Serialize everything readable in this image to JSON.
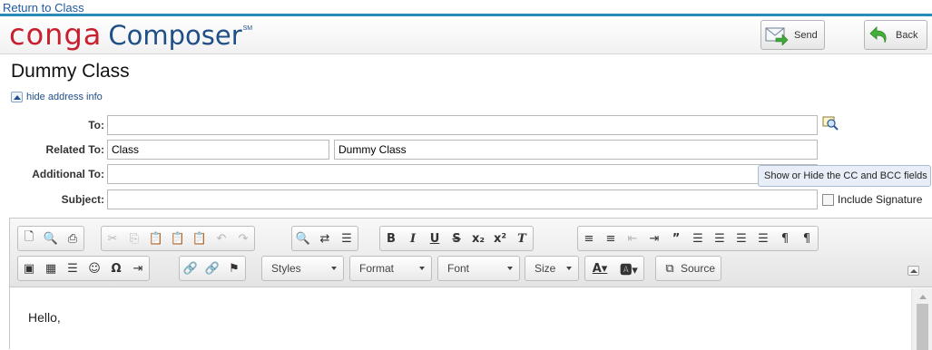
{
  "nav": {
    "return_link": "Return to Class"
  },
  "header": {
    "logo_word1": "conga",
    "logo_word2": "Composer",
    "logo_mark": "SM",
    "send_label": "Send",
    "back_label": "Back"
  },
  "page": {
    "title": "Dummy Class",
    "toggle_label": "hide address info"
  },
  "form": {
    "to_label": "To:",
    "to_value": "",
    "related_label": "Related To:",
    "related_object": "Class",
    "related_record": "Dummy Class",
    "additional_label": "Additional To:",
    "additional_value": "",
    "subject_label": "Subject:",
    "subject_value": "",
    "tooltip": "Show or Hide the CC and BCC fields",
    "signature_label": "Include Signature",
    "signature_checked": false
  },
  "editor": {
    "combos": {
      "styles": "Styles",
      "format": "Format",
      "font": "Font",
      "size": "Size"
    },
    "source_label": "Source",
    "body": "Hello,"
  },
  "colors": {
    "accent": "#2a8ab8",
    "brand_red": "#c8202f",
    "brand_blue": "#1e4f87",
    "link": "#1f5a9e"
  },
  "icons": [
    "send-mail-icon",
    "back-arrow-icon",
    "lookup-icon"
  ]
}
